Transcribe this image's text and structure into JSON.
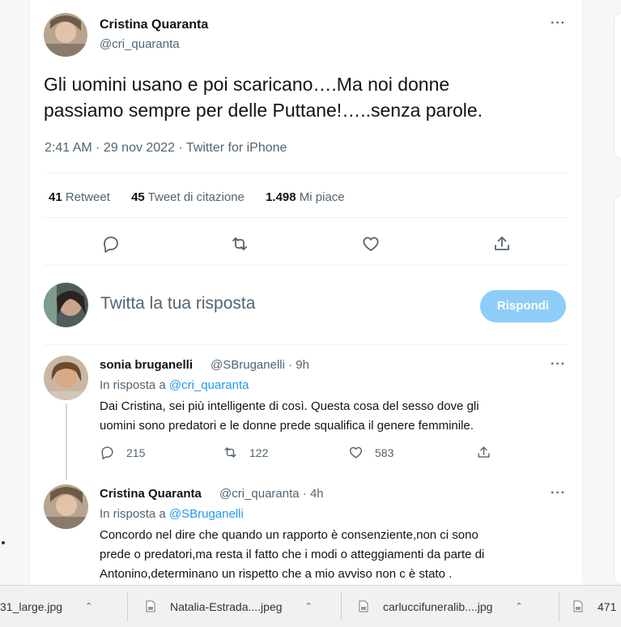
{
  "tweet": {
    "author_name": "Cristina Quaranta",
    "author_handle": "@cri_quaranta",
    "text_line1": "Gli uomini usano e poi scaricano….Ma noi donne",
    "text_line2": "passiamo sempre per delle Puttane!…..senza parole.",
    "meta": "2:41 AM · 29 nov 2022 · Twitter for iPhone",
    "stats": {
      "retweet_count": "41",
      "retweet_label": "Retweet",
      "quote_count": "45",
      "quote_label": "Tweet di citazione",
      "like_count": "1.498",
      "like_label": "Mi piace"
    },
    "more": "···"
  },
  "reply_box": {
    "placeholder": "Twitta la tua risposta",
    "button_label": "Rispondi"
  },
  "replies": [
    {
      "name": "sonia bruganelli",
      "handle_time": "@SBruganelli · 9h",
      "in_reply_prefix": "In risposta a ",
      "in_reply_to": "@cri_quaranta",
      "line1": "Dai Cristina, sei più intelligente di così. Questa cosa del sesso dove gli",
      "line2": "uomini sono predatori e le donne prede squalifica il genere femminile.",
      "reply_count": "215",
      "retweet_count": "122",
      "like_count": "583",
      "more": "···"
    },
    {
      "name": "Cristina Quaranta",
      "handle_time": "@cri_quaranta · 4h",
      "in_reply_prefix": "In risposta a ",
      "in_reply_to": "@SBruganelli",
      "line1": "Concordo nel dire che quando un rapporto è consenziente,non ci sono",
      "line2": "prede o predatori,ma resta il fatto che i modi o atteggiamenti da parte di",
      "line3": "Antonino,determinano un rispetto che a mio avviso non c è stato .",
      "more": "···"
    }
  ],
  "downloads": [
    {
      "name": "31_large.jpg"
    },
    {
      "name": "Natalia-Estrada....jpeg"
    },
    {
      "name": "carluccifuneralib....jpg"
    },
    {
      "name": "471"
    }
  ],
  "icons": {
    "reply": "reply-icon",
    "retweet": "retweet-icon",
    "like": "heart-icon",
    "share": "share-icon",
    "more": "more-icon",
    "file": "file-icon",
    "chevron": "chevron-up-icon"
  },
  "colors": {
    "accent": "#1d9bf0",
    "reply_button_disabled": "#8ecdf8",
    "text_primary": "#0f1419",
    "text_secondary": "#536471"
  }
}
